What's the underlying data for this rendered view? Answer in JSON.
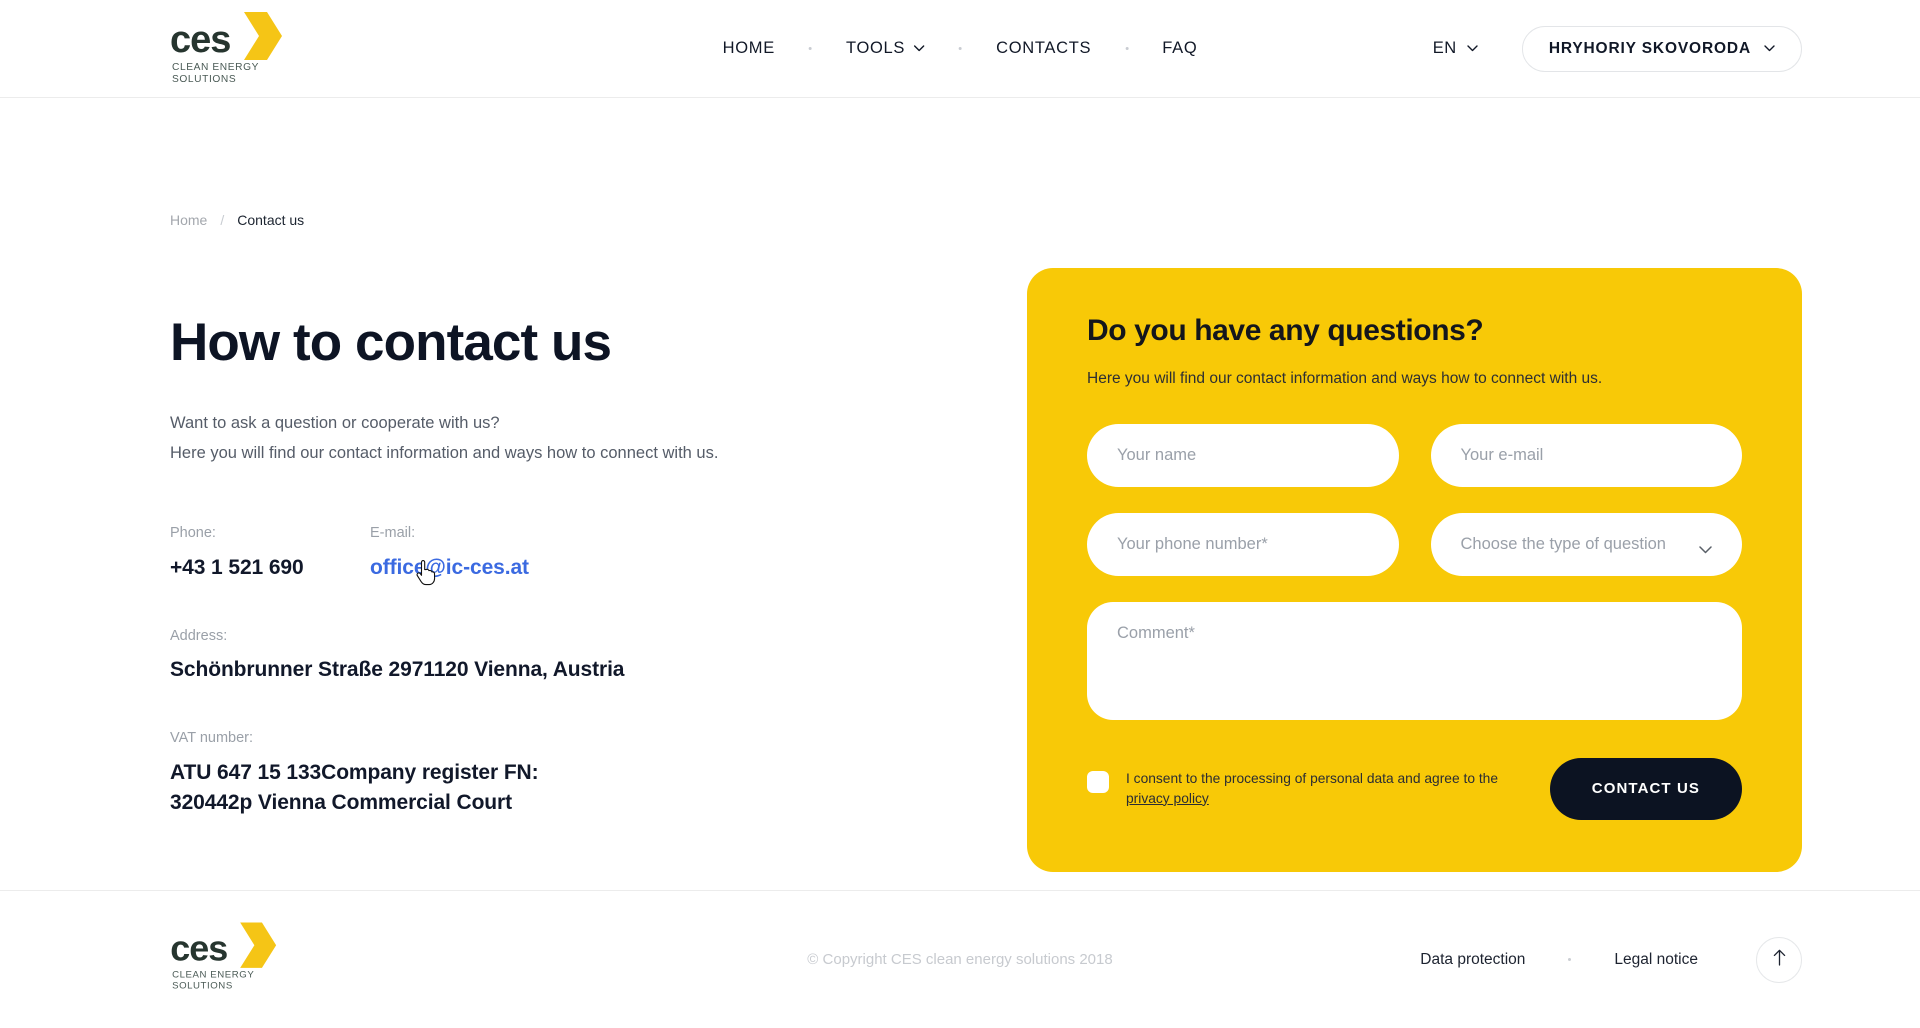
{
  "brand": {
    "name": "ces",
    "tagline_line1": "CLEAN ENERGY",
    "tagline_line2": "SOLUTIONS",
    "accent_yellow": "#F8C907",
    "dark": "#0c1322"
  },
  "header": {
    "nav": [
      {
        "label": "HOME",
        "has_chevron": false
      },
      {
        "label": "TOOLS",
        "has_chevron": true
      },
      {
        "label": "CONTACTS",
        "has_chevron": false
      },
      {
        "label": "FAQ",
        "has_chevron": false
      }
    ],
    "language": "EN",
    "user": "HRYHORIY SKOVORODA"
  },
  "breadcrumb": {
    "home": "Home",
    "separator": "/",
    "current": "Contact us"
  },
  "left": {
    "title": "How to contact us",
    "lede_line1": "Want to ask a question or cooperate with us?",
    "lede_line2": "Here you will find our contact information and ways how to connect with us.",
    "phone_label": "Phone:",
    "phone_value": "+43 1 521 690",
    "email_label": "E-mail:",
    "email_value": "office@ic-ces.at",
    "address_label": "Address:",
    "address_value": "Schönbrunner Straße 2971120 Vienna, Austria",
    "vat_label": "VAT number:",
    "vat_line1": "ATU 647 15 133Company register FN:",
    "vat_line2": "320442p Vienna Commercial Court"
  },
  "form": {
    "title": "Do you have any questions?",
    "subtitle": "Here you will find our contact information and ways how to connect with us.",
    "name_placeholder": "Your name",
    "name_value": "",
    "email_placeholder": "Your e-mail",
    "email_value": "",
    "phone_placeholder": "Your phone number*",
    "phone_value": "",
    "question_type_selected": "Choose the type of question",
    "question_type_options": [
      "Choose the type of question"
    ],
    "comment_placeholder": "Comment*",
    "comment_value": "",
    "consent_text": "I consent to the processing of personal data and agree to the",
    "consent_link": "privacy policy",
    "consent_checked": false,
    "submit_label": "CONTACT US"
  },
  "footer": {
    "copyright": "© Copyright CES clean energy solutions 2018",
    "links": [
      {
        "label": "Data protection"
      },
      {
        "label": "Legal notice"
      }
    ],
    "scroll_top_icon": "arrow-up-icon"
  }
}
